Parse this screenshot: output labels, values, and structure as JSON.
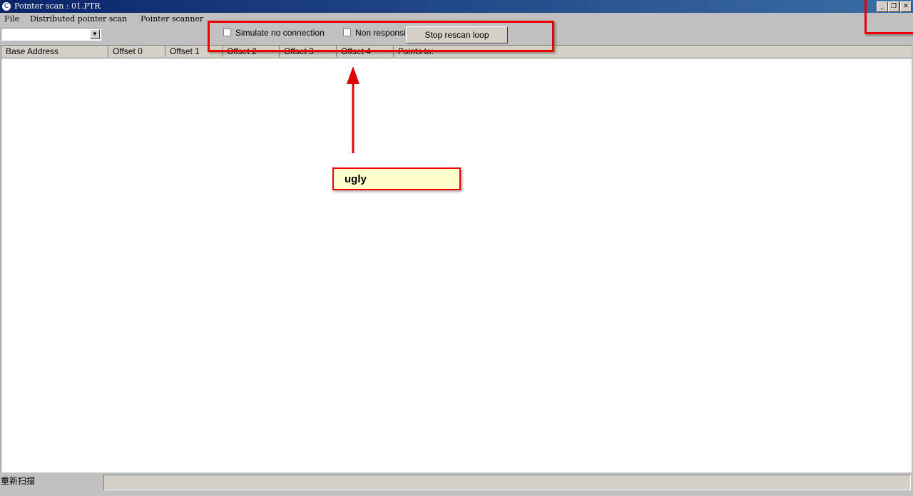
{
  "window": {
    "title": "Pointer scan : 01.PTR",
    "controls": [
      "minimize-icon",
      "restore-icon",
      "close-icon"
    ]
  },
  "menubar": {
    "items": [
      "File",
      "Distributed pointer scan",
      "Pointer scanner"
    ]
  },
  "toolbar": {
    "combo_value": "",
    "simulate_label": "Simulate no connection",
    "nonresponsive_label": "Non responsive",
    "stop_button_label": "Stop rescan loop"
  },
  "list": {
    "columns": [
      "Base Address",
      "Offset 0",
      "Offset 1",
      "Offset 2",
      "Offset 3",
      "Offset 4",
      "Points to:"
    ]
  },
  "statusbar": {
    "text": "重新扫描"
  },
  "annotation": {
    "callout_text": "ugly",
    "color": "#e00000"
  }
}
